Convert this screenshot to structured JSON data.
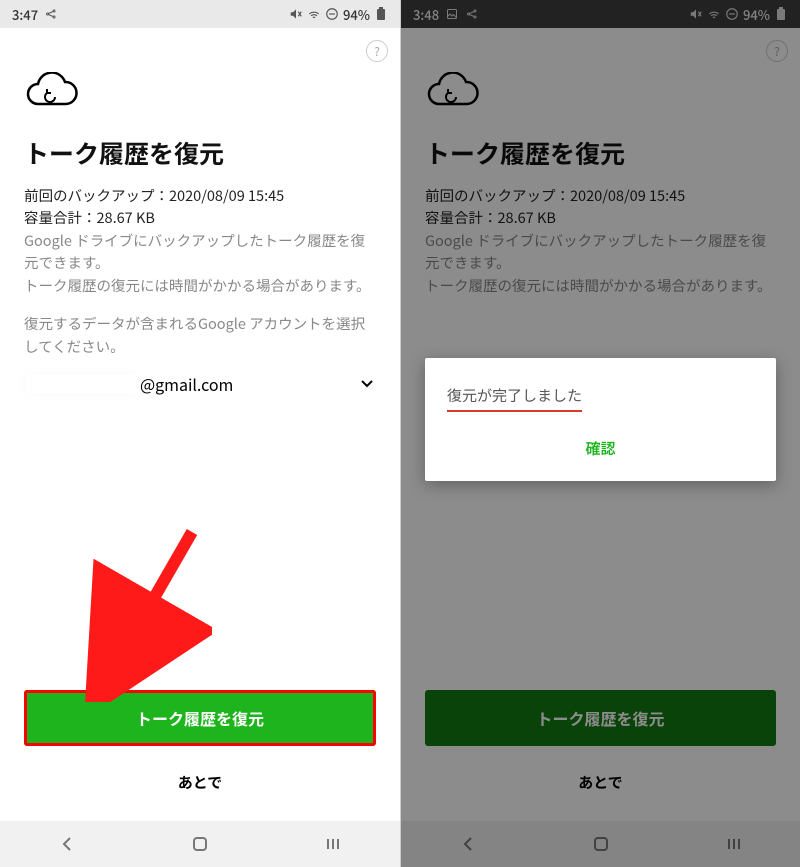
{
  "left": {
    "status": {
      "time": "3:47",
      "battery": "94%"
    },
    "title": "トーク履歴を復元",
    "last_backup_label": "前回のバックアップ：",
    "last_backup_value": "2020/08/09 15:45",
    "size_label": "容量合計：",
    "size_value": "28.67 KB",
    "desc1": "Google ドライブにバックアップしたトーク履歴を復元できます。",
    "desc2": "トーク履歴の復元には時間がかかる場合があります。",
    "desc3": "復元するデータが含まれるGoogle アカウントを選択してください。",
    "email_suffix": "@gmail.com",
    "primary_btn": "トーク履歴を復元",
    "later": "あとで",
    "help": "?"
  },
  "right": {
    "status": {
      "time": "3:48",
      "battery": "94%"
    },
    "title": "トーク履歴を復元",
    "last_backup_label": "前回のバックアップ：",
    "last_backup_value": "2020/08/09 15:45",
    "size_label": "容量合計：",
    "size_value": "28.67 KB",
    "desc1": "Google ドライブにバックアップしたトーク履歴を復元できます。",
    "desc2": "トーク履歴の復元には時間がかかる場合があります。",
    "primary_btn": "トーク履歴を復元",
    "later": "あとで",
    "help": "?",
    "dialog": {
      "message": "復元が完了しました",
      "ok": "確認"
    }
  },
  "icons": {
    "cloud": "cloud-restore-icon",
    "help": "help-icon",
    "caret": "chevron-down-icon",
    "mute": "volume-mute-icon",
    "dnd": "do-not-disturb-icon",
    "batt": "battery-icon",
    "image": "image-icon",
    "share": "share-icon",
    "back": "back-icon",
    "home": "home-icon",
    "recent": "recent-icon"
  }
}
